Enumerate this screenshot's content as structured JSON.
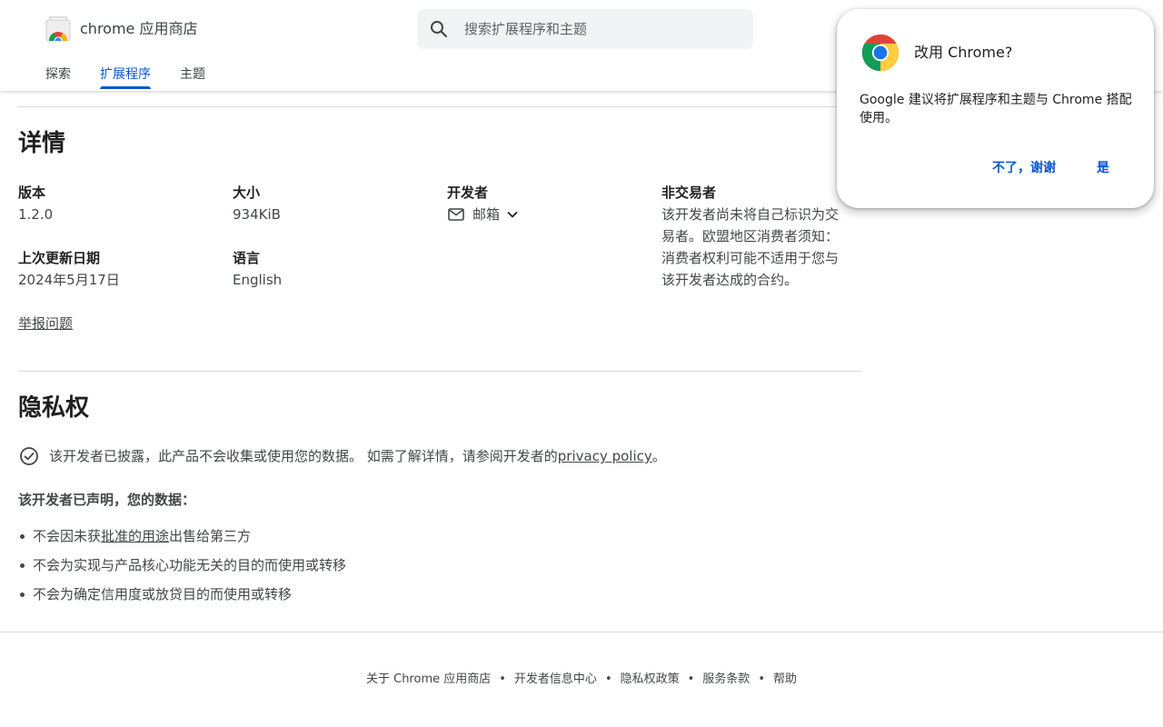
{
  "header": {
    "store_title": "chrome 应用商店",
    "search_placeholder": "搜索扩展程序和主题",
    "tabs": [
      {
        "label": "探索",
        "active": false
      },
      {
        "label": "扩展程序",
        "active": true
      },
      {
        "label": "主题",
        "active": false
      }
    ]
  },
  "details": {
    "title": "详情",
    "version_label": "版本",
    "version_value": "1.2.0",
    "size_label": "大小",
    "size_value": "934KiB",
    "developer_label": "开发者",
    "developer_email_label": "邮箱",
    "trader_label": "非交易者",
    "trader_desc": "该开发者尚未将自己标识为交易者。欧盟地区消费者须知：消费者权利可能不适用于您与该开发者达成的合约。",
    "updated_label": "上次更新日期",
    "updated_value": "2024年5月17日",
    "language_label": "语言",
    "language_value": "English",
    "report_link": "举报问题"
  },
  "privacy": {
    "title": "隐私权",
    "disclosure_text": "该开发者已披露，此产品不会收集或使用您的数据。 如需了解详情，请参阅开发者的",
    "policy_link": "privacy policy",
    "disclosure_end": "。",
    "declared_heading": "该开发者已声明，您的数据：",
    "bullet1_pre": "不会因未获",
    "bullet1_link": "批准的用途",
    "bullet1_post": "出售给第三方",
    "bullet2": "不会为实现与产品核心功能无关的目的而使用或转移",
    "bullet3": "不会为确定信用度或放贷目的而使用或转移"
  },
  "footer": {
    "links": [
      "关于 Chrome 应用商店",
      "开发者信息中心",
      "隐私权政策",
      "服务条款",
      "帮助"
    ],
    "separator": "•"
  },
  "popup": {
    "title": "改用 Chrome?",
    "body": "Google 建议将扩展程序和主题与 Chrome 搭配使用。",
    "no_button": "不了，谢谢",
    "yes_button": "是"
  },
  "colors": {
    "accent": "#0b57d0",
    "text_primary": "#1f1f1f",
    "text_secondary": "#444746",
    "search_bg": "#f1f3f4"
  },
  "icons": {
    "logo": "chrome-web-store-logo",
    "search": "search-icon",
    "email": "mail-icon",
    "chevron": "chevron-down-icon",
    "check": "check-circle-icon",
    "chrome": "chrome-logo"
  }
}
